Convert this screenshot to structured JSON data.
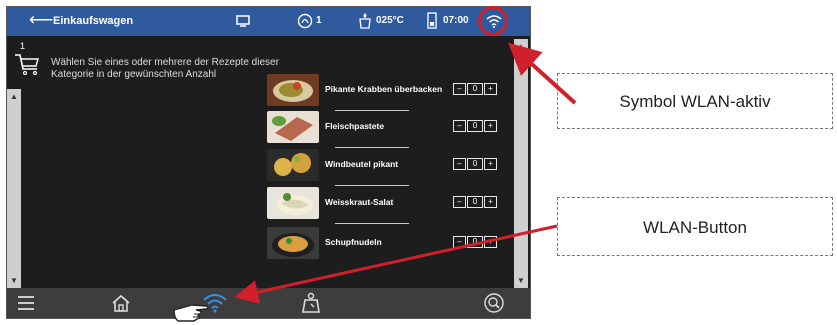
{
  "topbar": {
    "title": "Einkaufswagen",
    "badge_count": "1",
    "temperature": "025°C",
    "time": "07:00"
  },
  "basket": {
    "count": "1"
  },
  "instruction": "Wählen Sie eines oder mehrere der Rezepte dieser Kategorie in der gewünschten Anzahl",
  "recipes": [
    {
      "name": "Pikante Krabben überbacken",
      "qty": "0",
      "minus": "–",
      "plus": "+"
    },
    {
      "name": "Fleischpastete",
      "qty": "0",
      "minus": "–",
      "plus": "+"
    },
    {
      "name": "Windbeutel pikant",
      "qty": "0",
      "minus": "–",
      "plus": "+"
    },
    {
      "name": "Weisskraut-Salat",
      "qty": "0",
      "minus": "–",
      "plus": "+"
    },
    {
      "name": "Schupfnudeln",
      "qty": "0",
      "minus": "–",
      "plus": "+"
    }
  ],
  "callouts": {
    "wlan_active": "Symbol WLAN-aktiv",
    "wlan_button": "WLAN-Button"
  },
  "colors": {
    "topbar": "#2f5b9e",
    "screen_bg": "#1d1d1d",
    "bottombar": "#3d3d3d",
    "highlight_red": "#d11f2b",
    "wifi_blue": "#3f8fe0"
  }
}
